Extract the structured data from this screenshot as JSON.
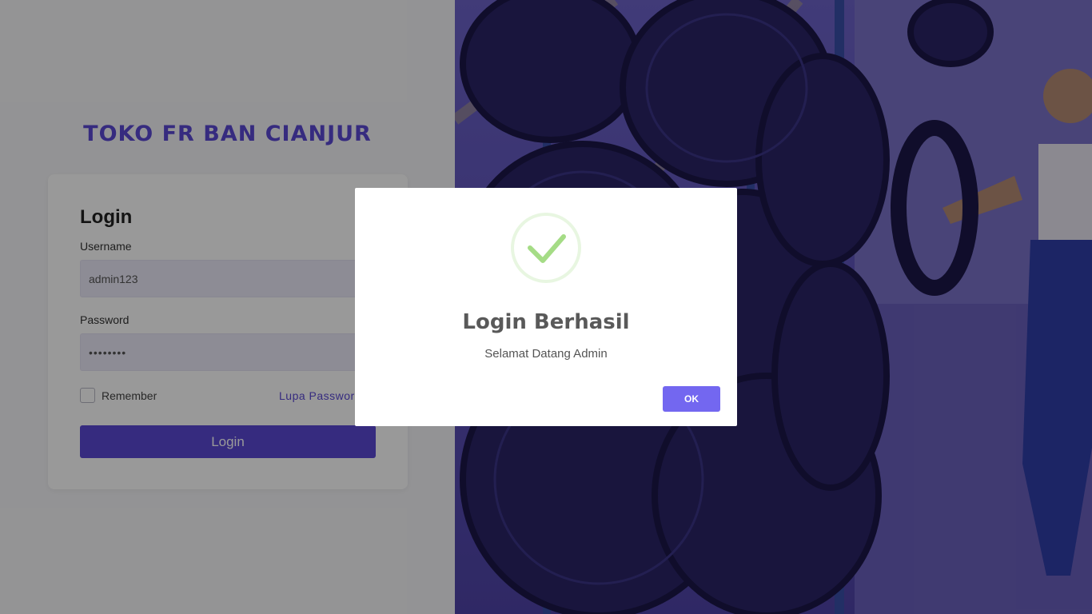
{
  "brand": {
    "title": "TOKO FR BAN CIANJUR"
  },
  "login_form": {
    "heading": "Login",
    "username_label": "Username",
    "username_value": "admin123",
    "password_label": "Password",
    "password_value": "••••••••",
    "remember_label": "Remember",
    "remember_checked": false,
    "forgot_link": "Lupa Password",
    "submit_label": "Login"
  },
  "modal": {
    "icon": "success-check-icon",
    "title": "Login Berhasil",
    "text": "Selamat Datang Admin",
    "confirm_label": "OK"
  },
  "colors": {
    "brand": "#5a48d4",
    "modal_confirm": "#7367f0",
    "success": "#a5dc86"
  }
}
